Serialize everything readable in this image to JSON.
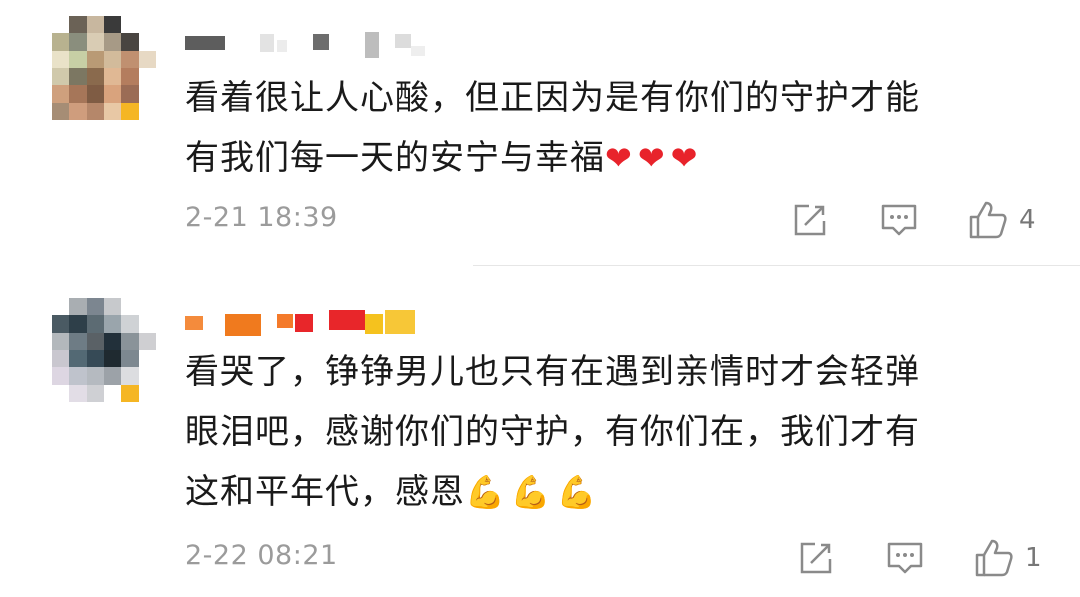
{
  "comments": [
    {
      "text_line_1": "看着很让人心酸，但正因为是有你们的守护才能",
      "text_line_2": "有我们每一天的安宁与幸福",
      "emojis": "❤❤❤",
      "timestamp": "2-21 18:39",
      "like_count": "4",
      "emoji_color": "#e8232b"
    },
    {
      "text_line_1": "看哭了，铮铮男儿也只有在遇到亲情时才会轻弹",
      "text_line_2": "眼泪吧，感谢你们的守护，有你们在，我们才有",
      "text_line_3": "这和平年代，感恩",
      "emojis": "💪💪💪",
      "timestamp": "2-22 08:21",
      "like_count": "1",
      "emoji_color": "#e9b06b"
    }
  ],
  "icons": {
    "share": "edit-share-icon",
    "reply": "comment-bubble-icon",
    "like": "thumbs-up-icon"
  },
  "colors": {
    "timestamp": "#9b9b9b",
    "text": "#1a1a1a",
    "icon": "#8a8a8a",
    "username_blur_1": "#f07a1e",
    "username_blur_2": "#e8262a"
  }
}
